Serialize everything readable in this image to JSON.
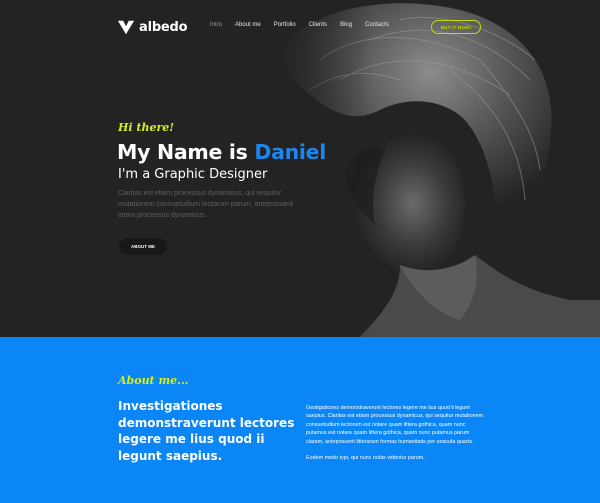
{
  "brand": {
    "name": "albedo"
  },
  "nav": {
    "items": [
      {
        "label": "Intro",
        "active": true
      },
      {
        "label": "About me",
        "active": false
      },
      {
        "label": "Portfolio",
        "active": false
      },
      {
        "label": "Clients",
        "active": false
      },
      {
        "label": "Blog",
        "active": false
      },
      {
        "label": "Contacts",
        "active": false
      }
    ],
    "cta_label": "BUY IT NOW!"
  },
  "hero": {
    "greeting": "Hi there!",
    "name_prefix": "My Name is ",
    "name_highlight": "Daniel",
    "role": "I'm a Graphic Designer",
    "lead": "Claritas est etiam processus dynamicus, qui sequitur mutationem consuetudium lectorum parum, anteposuerit etiam processus dynamicus.",
    "button_label": "ABOUT ME"
  },
  "about": {
    "kicker": "About me...",
    "heading": "Investigationes demonstraverunt lectores legere me lius quod ii legunt saepius.",
    "paragraphs": [
      "Gestigationes demonstraverunt lectores legere me lius quod ii legunt saepius. Claritas est etiam processus dynamicus, qui sequitur mutationem consuetudium lectorum est notare quam littera gothica, quam nunc putamus est notare quam littera gothica, quam nunc putamus parum claram, anteposuerit litterarum formas humanitatis per seacula quarta.",
      "Eodem modo typi, qui nunc nobis videntur parum."
    ]
  },
  "colors": {
    "accent_blue": "#1a87f0",
    "accent_yellow": "#d6ee1a",
    "hero_bg": "#232323",
    "about_bg": "#0a86f6"
  }
}
